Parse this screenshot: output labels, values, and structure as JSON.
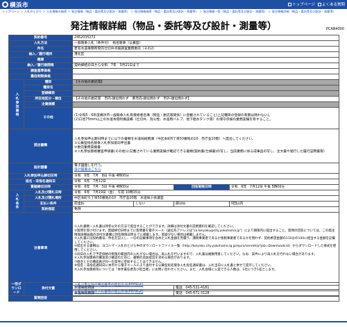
{
  "header": {
    "logo_text": "横浜市",
    "actions": [
      "トップページ",
      "よくある質問"
    ]
  },
  "breadcrumb": "トップページ ＞ 入札のとびら ＞ 入札情報の検索 ＞ 発注情報（物品・委託等及び設計・測量等） ＞ 発注情報検索（物品・委託等及び設計・測量等） ＞ 発注情報一覧（物品・委託等及び設計・測量等） ＞ 発注情報詳細（物品・委託等及び設計・測量等）",
  "page_title": "発注情報詳細（物品・委託等及び設計・測量等）",
  "page_code": "PCAB4000",
  "side_labels": {
    "bidder": "入札参加資格",
    "conditions": "入札条件"
  },
  "rows": {
    "contract_no": {
      "label": "契約番号",
      "value": "2452035272"
    },
    "method": {
      "label": "入札方法",
      "value": "一般競争入札（条件付）　指名競争（公募型）"
    },
    "item": {
      "label": "件名",
      "value": "若名水道事務所管内仕切弁点検調査業務委託（その2）"
    },
    "place": {
      "label": "納入／履行場所",
      "value": "港北区"
    },
    "summary": {
      "label": "概要",
      "value": ""
    },
    "period": {
      "label": "納入／履行期間等",
      "value": "契約締結の日から令和　7年　3月21日まで"
    },
    "design_doc": {
      "label": "調査基準価格",
      "value": ""
    },
    "min_price": {
      "label": "最低制限価格",
      "value": ""
    },
    "category": {
      "label": "種目",
      "value": "【その他の委託等】"
    },
    "sub_category": {
      "label": "種目名",
      "value": ""
    },
    "reg_grade": {
      "label": "登録細目",
      "value": ""
    },
    "location": {
      "label": "所在地区分・順位",
      "value": "【その他の委託等　市内-順位問わず　準市内-順位問わず　市外-順位問わず】"
    },
    "company": {
      "label": "企業規模",
      "value": ""
    },
    "other": {
      "label": "その他",
      "value": "(1)令和5・6年度横浜市一般競争入札有資格者名簿（物品・委託等関係）に登載されていること(上記種目の登録の有無は問わない)。\n(2)口径75mm以上の水道本管附属設備（仕切弁、消火栓、水道用バルブ、地下給水タンク等）の保守点検の業務実績を有すること。"
    },
    "submission": {
      "label": "提出書類",
      "value": "入札参加申込期日時までに以下の書類を水道局総務課（中区本町6丁目50番地の10　市庁舎20階）へ提出してください。\n①公募型指名競争入札参加意向申出書\n②委託業務実績書\n③入札参加資格審査申請書(その他)に記載されている業務実績が確認できる書類(契約書(仕様書)の写し、当該業務に係る成果品の写し、注文書や発行した履行証明書等)"
    },
    "design": {
      "label": "設計図書",
      "value": "電子図面しを行う。",
      "link": "設計図書はこちら"
    },
    "apply_date": {
      "label": "入札参加申込締切日時",
      "value": "令和　6年　7月　8日 午後 4時00分"
    },
    "notify_date": {
      "label": "指名・非指名通知日",
      "value": "令和　6年　7月12日"
    },
    "qa_period": {
      "label": "質疑締切日時",
      "value": "令和　6年　7月　5日 午後 4時00分",
      "ans_label": "回答期限日時",
      "ans_value": "令和　6年　7月12日 午後 5時00分"
    },
    "bid_date": {
      "label": "入札及び開札日時",
      "value": "令和　6年　7月19日（金）　午前 10時15分"
    },
    "bid_place": {
      "label": "入札及び開札場所",
      "value": "中区本町６丁目50番地の10　市庁舎20階　水道局小会議室"
    },
    "payment": {
      "label": "支払い条件",
      "c1": "前金払",
      "c2": "しない",
      "c3": "部分払",
      "c4": "0回以内"
    },
    "deposit": {
      "label": "契約保証",
      "value": "免除"
    },
    "notes": {
      "label": "注意事項",
      "value": "①入札書類・入札書は持参以外の方法で提出することができます。詳細は添付文書の説明資料を確認してください。\n②質問を受け付けます。質疑締切日時までに質問書を電子メール（送信先アドレスは\"su-keiyaku@city.yokohama.jp\"）により期限内に提出すること。質問の回答については、この発注情報詳細画面の添付文書欄に回答期限日時までに掲載します。質疑がない場合は掲載しません。\n③入札書には契約番号、件名を記入し、一切の記載事項を含めた入札金額を見積り、課税事業者であるか免税事業者であるかを問わず、契約希望金額の110分の100に相当する金額を記載してください。\n④提出する書類は、ヨコハマ・入札のとびら中のダウンロードファイル一覧（http://keiyaku.city.yokohama.lg.jp/epco/servlet/p?job=DownloadList）からダウンロードした様式を使用してください。\n⑤同日の入札で予定価格の制限の範囲内の入札がない場合は、再入札を行いますので、入札書は複数用意してください。なお、案件により再入札を行わない場合があります。\n⑥入札参加資格の審査及び確認のために、書類の追加提出を求める場合があります。\n⑦組合とその構成員が同一の案件に参加することはできません。\n⑧指名・非指名通知日に本市から電子メールにより送付する公募型指名競争入札指名通知書は、入札当日に入札書と併せて提示してください。\n⑨入札参加資格等については「本件責任者及び担当者」にお問い合わせください。また、入札会場に入室できる人数は、1社につき1名とします。"
    },
    "division": {
      "label": "発注担当課",
      "value": "水道局総務課",
      "tel": "電話　045-531-4181"
    },
    "contract_division": {
      "label": "契約事務担当課",
      "value": "水道局総務課",
      "tel": "電話　045-671-3128"
    }
  },
  "attachments": {
    "label": "一括ダウンロード",
    "rows": [
      {
        "label": "添付文書",
        "value": "入札公告以外の申出書等の提出方法(PDF形式)"
      },
      {
        "label": "",
        "value": "入札公告以外の入札書等の提出方法(PDF形式)"
      },
      {
        "label": "質問回答",
        "value": ""
      }
    ]
  }
}
